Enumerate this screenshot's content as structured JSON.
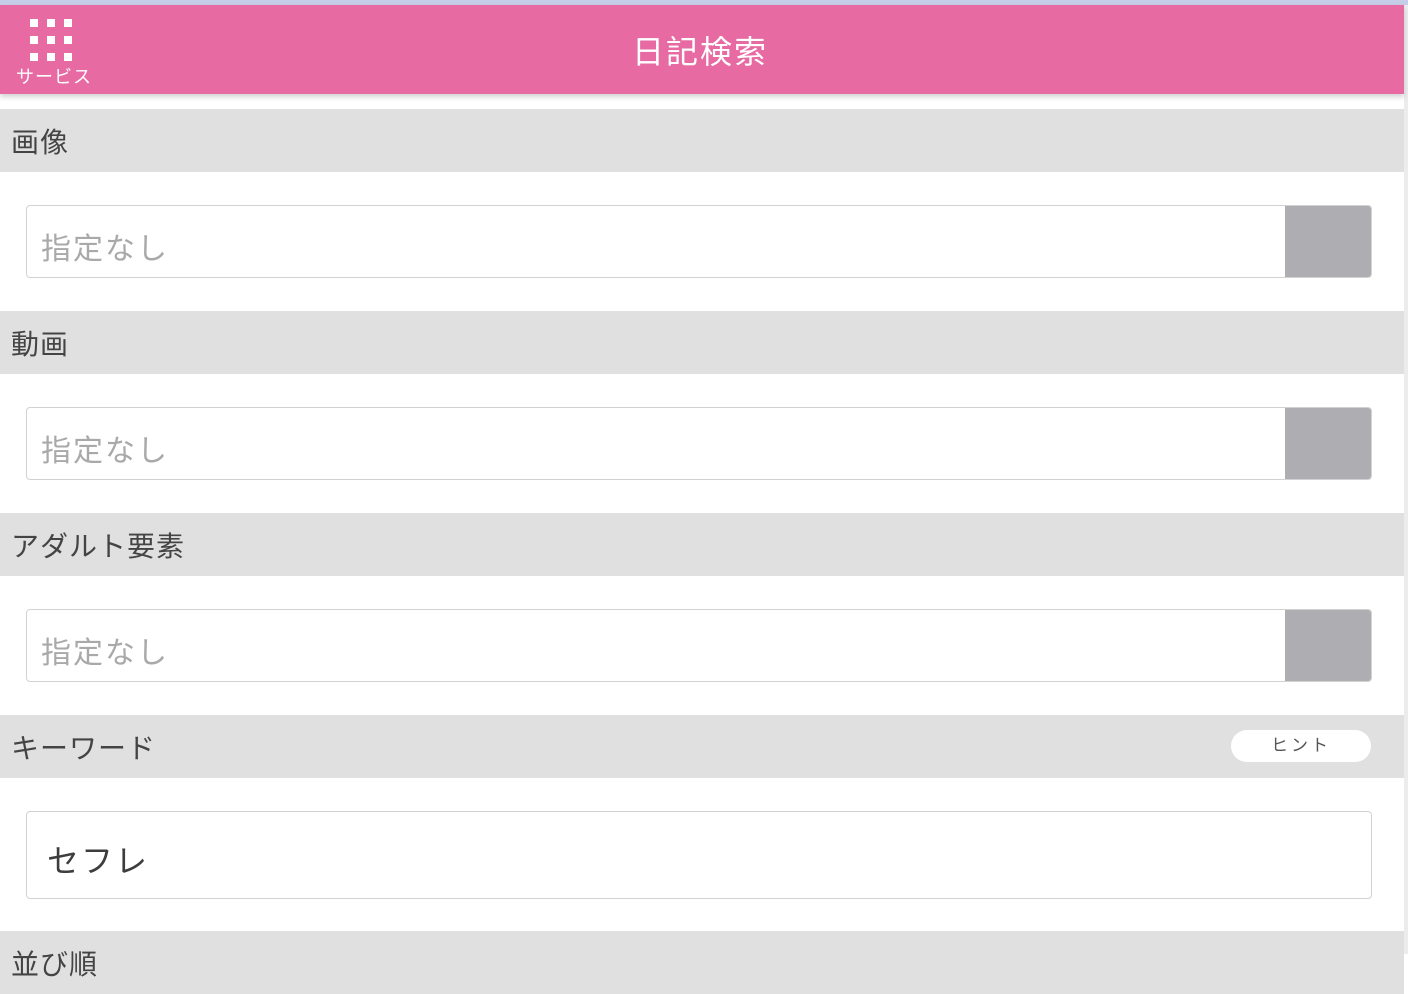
{
  "header": {
    "service_label": "サービス",
    "title": "日記検索",
    "icon": "grid-icon",
    "background_color": "#e76aa3"
  },
  "sections": {
    "image": {
      "label": "画像",
      "select_value": "指定なし"
    },
    "video": {
      "label": "動画",
      "select_value": "指定なし"
    },
    "adult": {
      "label": "アダルト要素",
      "select_value": "指定なし"
    },
    "keyword": {
      "label": "キーワード",
      "hint_label": "ヒント",
      "input_value": "セフレ"
    },
    "sort": {
      "label": "並び順"
    }
  },
  "colors": {
    "section_header_bg": "#e0e0e0",
    "select_button_bg": "#adadb2",
    "placeholder_text": "#a9a9a9"
  }
}
